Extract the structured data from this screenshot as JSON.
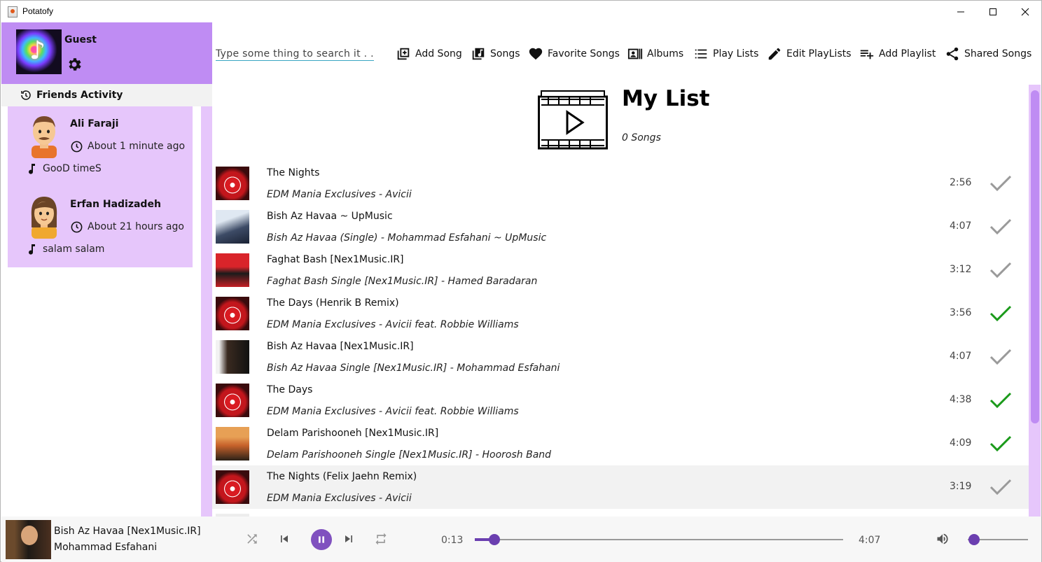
{
  "window": {
    "title": "Potatofy"
  },
  "profile": {
    "name": "Guest"
  },
  "friends": {
    "header": "Friends Activity",
    "items": [
      {
        "name": "Ali Faraji",
        "time": "About 1 minute ago",
        "song": "GooD timeS"
      },
      {
        "name": "Erfan Hadizadeh",
        "time": "About 21 hours ago",
        "song": "salam salam"
      }
    ]
  },
  "search": {
    "placeholder": "Type some thing to search it . . ."
  },
  "toolbar": {
    "add_song": "Add Song",
    "songs": "Songs",
    "favorite_songs": "Favorite Songs",
    "albums": "Albums",
    "play_lists": "Play Lists",
    "edit_playlists": "Edit PlayLists",
    "add_playlist": "Add Playlist",
    "shared_songs": "Shared Songs"
  },
  "playlist": {
    "title": "My List",
    "count": "0 Songs"
  },
  "songs": [
    {
      "title": "The Nights",
      "subtitle": "EDM Mania Exclusives - Avicii",
      "duration": "2:56",
      "checked": false
    },
    {
      "title": "Bish Az Havaa ~ UpMusic",
      "subtitle": "Bish Az Havaa (Single) - Mohammad Esfahani  ~ UpMusic",
      "duration": "4:07",
      "checked": false
    },
    {
      "title": "Faghat Bash [Nex1Music.IR]",
      "subtitle": "Faghat Bash Single [Nex1Music.IR] - Hamed Baradaran",
      "duration": "3:12",
      "checked": false
    },
    {
      "title": "The Days (Henrik B Remix)",
      "subtitle": "EDM Mania Exclusives - Avicii feat. Robbie Williams",
      "duration": "3:56",
      "checked": true
    },
    {
      "title": "Bish Az Havaa [Nex1Music.IR]",
      "subtitle": "Bish Az Havaa Single [Nex1Music.IR] - Mohammad Esfahani",
      "duration": "4:07",
      "checked": false
    },
    {
      "title": "The Days",
      "subtitle": "EDM Mania Exclusives - Avicii feat. Robbie Williams",
      "duration": "4:38",
      "checked": true
    },
    {
      "title": "Delam Parishooneh [Nex1Music.IR]",
      "subtitle": "Delam Parishooneh Single [Nex1Music.IR] - Hoorosh Band",
      "duration": "4:09",
      "checked": true
    },
    {
      "title": "The Nights (Felix Jaehn Remix)",
      "subtitle": "EDM Mania Exclusives - Avicii",
      "duration": "3:19",
      "checked": false
    }
  ],
  "player": {
    "title": "Bish Az Havaa [Nex1Music.IR]",
    "artist": "Mohammad Esfahani",
    "current_time": "0:13",
    "total_time": "4:07",
    "progress_fraction": 0.053,
    "volume_fraction": 0.1
  },
  "colors": {
    "accent": "#bf8cf3",
    "accent_light": "#e6c6fb",
    "control": "#8051bf",
    "check_on": "#1a9a1a",
    "check_off": "#9a9a9a"
  },
  "icons": {
    "history": "history-icon",
    "settings": "gear-icon",
    "clock": "clock-icon",
    "note": "music-note-icon",
    "check": "check-icon"
  }
}
